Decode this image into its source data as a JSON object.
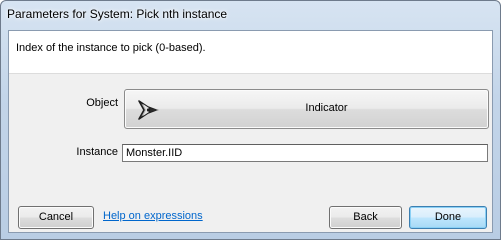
{
  "window": {
    "title": "Parameters for System: Pick nth instance"
  },
  "header": {
    "description": "Index of the instance to pick (0-based)."
  },
  "form": {
    "object_label": "Object",
    "object_value": "Indicator",
    "object_icon": "indicator-arrow-icon",
    "instance_label": "Instance",
    "instance_value": "Monster.IID"
  },
  "footer": {
    "cancel_label": "Cancel",
    "help_link": "Help on expressions",
    "back_label": "Back",
    "done_label": "Done"
  },
  "colors": {
    "link": "#0066cc",
    "done_border": "#3c7fb1",
    "titlebar": "#c3d5e9"
  }
}
